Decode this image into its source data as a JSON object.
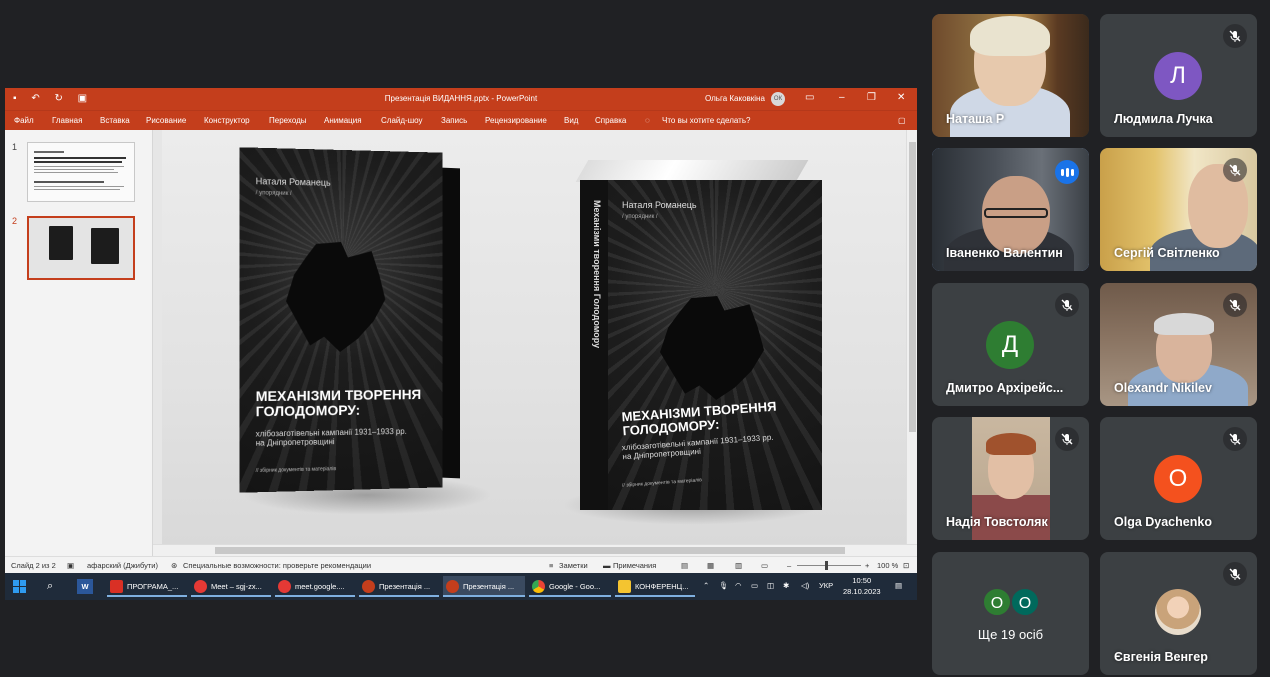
{
  "ppt": {
    "window_title": "Презентація ВИДАННЯ.pptx - PowerPoint",
    "user_name": "Ольга Каковкіна",
    "user_initials": "ОК",
    "tabs": [
      "Файл",
      "Главная",
      "Вставка",
      "Рисование",
      "Конструктор",
      "Переходы",
      "Анимация",
      "Слайд-шоу",
      "Запись",
      "Рецензирование",
      "Вид",
      "Справка"
    ],
    "tell_me": "Что вы хотите сделать?",
    "slide_numbers": [
      "1",
      "2"
    ],
    "status_slide": "Слайд 2 из 2",
    "status_lang": "афарский (Джибути)",
    "status_access": "Специальные возможности: проверьте рекомендации",
    "notes_label": "Заметки",
    "comments_label": "Примечания",
    "zoom": "100 %"
  },
  "book": {
    "author": "Наталя Романець",
    "role": "/ упорядник /",
    "title_line1": "МЕХАНІЗМИ ТВОРЕННЯ",
    "title_line2": "ГОЛОДОМОРУ:",
    "subtitle_line1": "хлібозаготівельні кампанії 1931–1933 рр.",
    "subtitle_line2": "на Дніпропетровщині",
    "series": "// збірник документів та матеріалів",
    "spine": "Механізми творення Голодомору"
  },
  "taskbar": {
    "apps": [
      "ПРОГРАМА_...",
      "Meet – sgj-zx...",
      "meet.google....",
      "Презентація ...",
      "Презентація ...",
      "Google - Goo...",
      "КОНФЕРЕНЦ..."
    ],
    "lang": "УКР",
    "time": "10:50",
    "date": "28.10.2023"
  },
  "participants": [
    {
      "name": "Наташа Р"
    },
    {
      "name": "Людмила Лучка",
      "initial": "Л"
    },
    {
      "name": "Іваненко Валентин"
    },
    {
      "name": "Сергій Світленко"
    },
    {
      "name": "Дмитро Архірейс...",
      "initial": "Д"
    },
    {
      "name": "Olexandr Nikilev"
    },
    {
      "name": "Надія Товстоляк"
    },
    {
      "name": "Olga Dyachenko",
      "initial": "O"
    },
    {
      "more_label": "Ще 19 осіб",
      "initials": [
        "O",
        "O"
      ]
    },
    {
      "name": "Євгенія Венгер"
    }
  ],
  "colors": {
    "ppt_accent": "#c43e1c",
    "tile_bg": "#3c4043",
    "speaking": "#8ab4f8",
    "avatar_l": "#7e57c2",
    "avatar_d": "#2e7d32",
    "avatar_o": "#f4511e",
    "more_a": "#2e7d32",
    "more_b": "#00695c"
  }
}
